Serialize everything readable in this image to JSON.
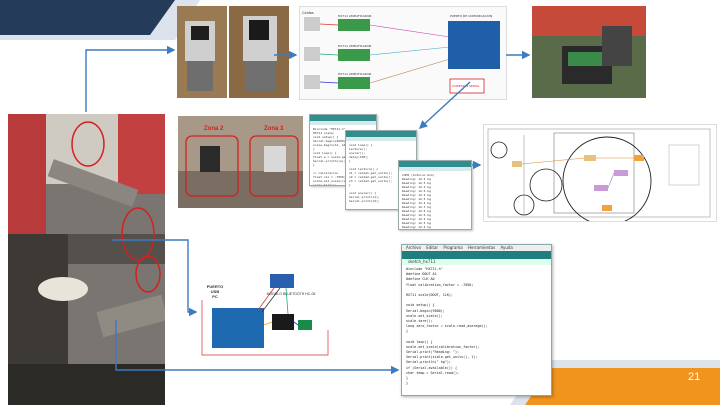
{
  "slide": {
    "page_number": "21"
  },
  "colors": {
    "accent_navy": "#243c5a",
    "accent_orange": "#f0941e",
    "arrow_blue": "#3b7bbf",
    "highlight_red": "#d42020"
  },
  "photos": {
    "zone_left_label": "Zona 2",
    "zone_right_label": "Zona 3"
  },
  "diagram": {
    "title_left": "Celdas",
    "amp_labels": [
      "HX711 AMPLIFICADOR",
      "HX711 AMPLIFICADOR",
      "HX711 AMPLIFICADOR"
    ],
    "board_label": "PUERTO DE COMUNICACIÓN",
    "red_tag": "CONEXIÓN SERIAL"
  },
  "wiring": {
    "left_label": "PUERTO\nUSB\nPC",
    "module_label": "MODULO BLUETOOTH HC-05"
  },
  "ide": {
    "menu": [
      "Archivo",
      "Editar",
      "Programa",
      "Herramientas",
      "Ayuda"
    ],
    "tab": "sketch_hx711",
    "lines": [
      "#include \"HX711.h\"",
      "#define DOUT  A1",
      "#define CLK  A0",
      "float calibration_factor = -7050;",
      "",
      "HX711 scale(DOUT, CLK);",
      "",
      "void setup() {",
      "  Serial.begin(9600);",
      "  scale.set_scale();",
      "  scale.tare();",
      "  long zero_factor = scale.read_average();",
      "}",
      "",
      "void loop() {",
      "  scale.set_scale(calibration_factor);",
      "  Serial.print(\"Reading: \");",
      "  Serial.print(scale.get_units(), 1);",
      "  Serial.println(\" kg\");",
      "  if (Serial.available()) {",
      "    char temp = Serial.read();",
      "  }",
      "}"
    ]
  },
  "code_small": {
    "lines_a": [
      "#include \"HX711.h\"",
      "HX711 scale;",
      "void setup() {",
      "  Serial.begin(9600);",
      "  scale.begin(A1, A0);",
      "}",
      "void loop() {",
      "  float w = scale.get_units();",
      "  Serial.println(w);",
      "}",
      "",
      "// calibracion",
      "float cal = -7050;",
      "scale.set_scale(cal);",
      "scale.tare();"
    ],
    "lines_b": [
      "void loop() {",
      "  lectura();",
      "  enviar();",
      "  delay(100);",
      "}",
      "",
      "void lectura() {",
      "  z1 = celda1.get_units();",
      "  z2 = celda2.get_units();",
      "  z3 = celda3.get_units();",
      "}",
      "",
      "void enviar() {",
      "  Serial.print(z1);",
      "  Serial.print(z2);"
    ],
    "lines_c": [
      "COM3 (Arduino Uno)",
      "Reading: 12.4 kg",
      "Reading: 12.5 kg",
      "Reading: 12.3 kg",
      "Reading: 12.6 kg",
      "Reading: 12.4 kg",
      "Reading: 12.5 kg",
      "Reading: 12.4 kg",
      "Reading: 12.3 kg",
      "Reading: 12.5 kg",
      "Reading: 12.6 kg",
      "Reading: 12.4 kg",
      "Reading: 12.5 kg",
      "Reading: 12.4 kg",
      "Reading: 12.3 kg",
      "Reading: 12.5 kg"
    ]
  }
}
